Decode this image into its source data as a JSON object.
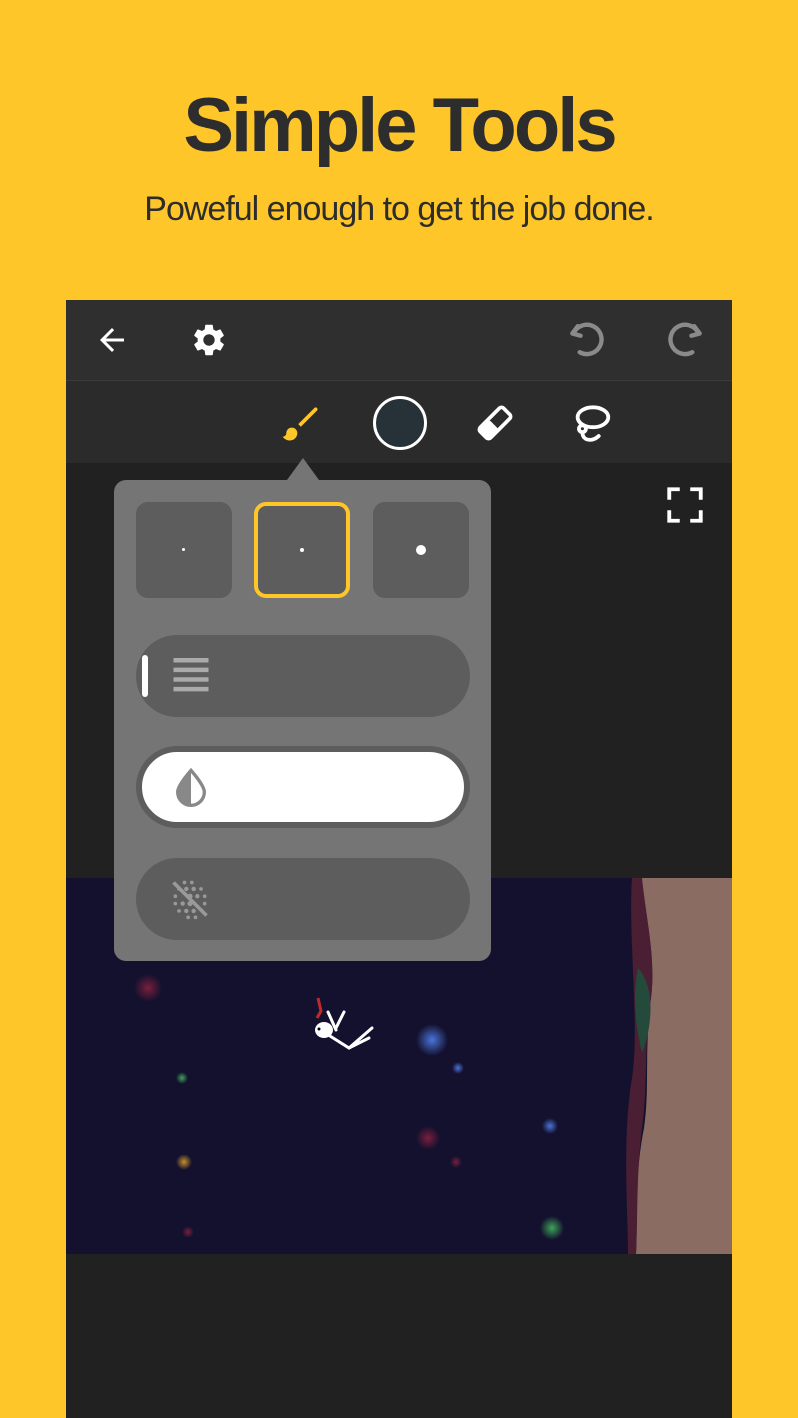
{
  "header": {
    "title": "Simple Tools",
    "subtitle": "Poweful enough to get the job done."
  },
  "topbar": {
    "icons": [
      "back-arrow-icon",
      "gear-icon",
      "undo-icon",
      "redo-icon"
    ]
  },
  "toolbar": {
    "active_tool": "brush",
    "tools": [
      "brush-icon",
      "color-swatch",
      "eraser-icon",
      "lasso-icon"
    ],
    "current_color": "#263238"
  },
  "brush_popup": {
    "sizes": [
      "small",
      "medium",
      "large"
    ],
    "selected_size": "medium",
    "layers_slider_level": 0.03,
    "opacity_slider_level": 1.0,
    "texture_slider_level": 0.0
  },
  "colors": {
    "accent": "#FFC629",
    "background": "#FFC629",
    "canvas_sky": "#14112e"
  }
}
